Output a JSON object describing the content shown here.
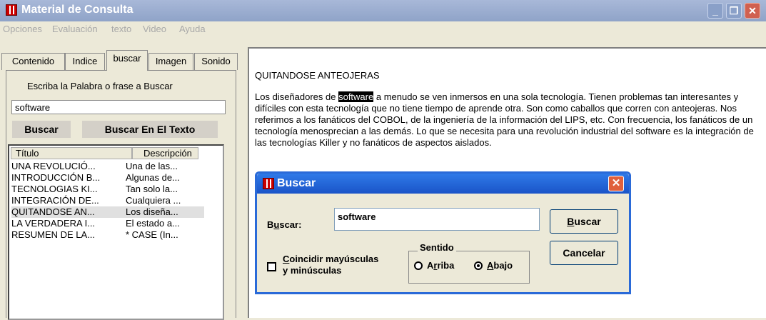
{
  "window": {
    "title": "Material de Consulta",
    "controls": {
      "minimize": "_",
      "maximize": "❐",
      "close": "✕"
    }
  },
  "menu": [
    "Opciones",
    "Evaluación",
    "texto",
    "Video",
    "Ayuda"
  ],
  "tabs": [
    "Contenido",
    "Indice",
    "buscar",
    "Imagen",
    "Sonido"
  ],
  "search_panel": {
    "prompt": "Escriba la Palabra o frase a Buscar",
    "input_value": "software",
    "buscar_button": "Buscar",
    "buscar_texto_button": "Buscar En El Texto"
  },
  "results": {
    "columns": [
      "Título",
      "Descripción"
    ],
    "selected_index": 4,
    "rows": [
      {
        "titulo": "UNA REVOLUCIÓ...",
        "descripcion": "Una de las..."
      },
      {
        "titulo": "INTRODUCCIÓN B...",
        "descripcion": "Algunas de..."
      },
      {
        "titulo": "TECNOLOGIAS KI...",
        "descripcion": "Tan solo la..."
      },
      {
        "titulo": "INTEGRACIÓN DE...",
        "descripcion": "Cualquiera ..."
      },
      {
        "titulo": "QUITANDOSE AN...",
        "descripcion": "Los diseña..."
      },
      {
        "titulo": "LA VERDADERA I...",
        "descripcion": "El estado a..."
      },
      {
        "titulo": "RESUMEN DE LA...",
        "descripcion": "* CASE (In..."
      }
    ]
  },
  "document": {
    "title": "QUITANDOSE ANTEOJERAS",
    "body_before": "Los diseñadores de ",
    "highlight": "software",
    "body_after": " a menudo se ven inmersos en una sola tecnología. Tienen problemas tan interesantes y difíciles con esta tecnología que no tiene tiempo de aprende otra. Son como caballos que corren con anteojeras. Nos referimos a los fanáticos del COBOL, de la ingeniería de la información del LIPS, etc. Con frecuencia, los fanáticos de un tecnología menosprecian a las demás. Lo que se necesita para una revolución industrial del software es la integración de las tecnologías Killer y no fanáticos de aspectos aislados."
  },
  "dialog": {
    "title": "Buscar",
    "close": "✕",
    "field_label_pre": "B",
    "field_label_u": "u",
    "field_label_post": "scar:",
    "field_value": "software",
    "find_button_u": "B",
    "find_button_rest": "uscar",
    "cancel_button": "Cancelar",
    "match_case_u": "C",
    "match_case_line1_rest": "oincidir mayúsculas",
    "match_case_line2": "y minúsculas",
    "direction_legend": "Sentido",
    "up_pre": "A",
    "up_u": "r",
    "up_post": "riba",
    "down_u": "A",
    "down_post": "bajo",
    "direction_selected": "down"
  }
}
